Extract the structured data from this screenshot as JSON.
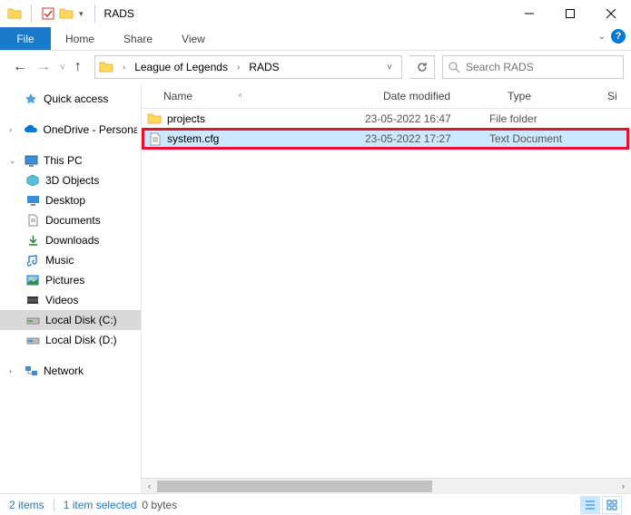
{
  "title": "RADS",
  "ribbon": {
    "file": "File",
    "tabs": [
      "Home",
      "Share",
      "View"
    ]
  },
  "breadcrumbs": [
    "League of Legends",
    "RADS"
  ],
  "search": {
    "placeholder": "Search RADS"
  },
  "sidebar": {
    "quick_access": "Quick access",
    "onedrive": "OneDrive - Personal",
    "this_pc": "This PC",
    "children": [
      "3D Objects",
      "Desktop",
      "Documents",
      "Downloads",
      "Music",
      "Pictures",
      "Videos",
      "Local Disk (C:)",
      "Local Disk (D:)"
    ],
    "network": "Network"
  },
  "columns": {
    "name": "Name",
    "date": "Date modified",
    "type": "Type",
    "size": "Si"
  },
  "rows": [
    {
      "name": "projects",
      "date": "23-05-2022 16:47",
      "type": "File folder",
      "kind": "folder",
      "selected": false
    },
    {
      "name": "system.cfg",
      "date": "23-05-2022 17:27",
      "type": "Text Document",
      "kind": "file",
      "selected": true
    }
  ],
  "status": {
    "items": "2 items",
    "selected": "1 item selected",
    "size": "0 bytes"
  }
}
